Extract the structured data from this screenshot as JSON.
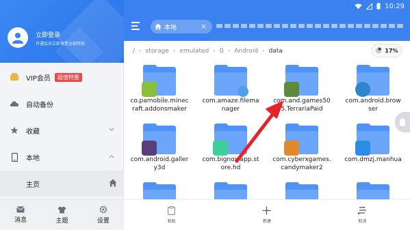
{
  "status_bar": {
    "time": "10:29"
  },
  "sidebar": {
    "login_title": "立即登录",
    "login_subtitle": "开通会员立即享受全部特权",
    "vip_label": "VIP会员",
    "vip_badge": "超值特惠",
    "backup_label": "自动备份",
    "favorites_label": "收藏",
    "local_label": "本地",
    "home_label": "主页",
    "bottom_tabs": [
      {
        "label": "消息",
        "icon": "mail-icon"
      },
      {
        "label": "主题",
        "icon": "shirt-icon"
      },
      {
        "label": "设置",
        "icon": "gear-icon"
      }
    ]
  },
  "toolbar": {
    "tab_label": "本地"
  },
  "breadcrumb": [
    "/",
    "storage",
    "emulated",
    "0",
    "Android",
    "data"
  ],
  "storage_percent": "17%",
  "files": [
    {
      "name_line1": "co.pamobile.minec",
      "name_line2": "raft.addonsmaker",
      "app_color": "#8bbf3a"
    },
    {
      "name_line1": "com.amaze.filema",
      "name_line2": "nager",
      "app_color": "#4fa0e8"
    },
    {
      "name_line1": "com.and.games50",
      "name_line2": "5.TerrariaPaid",
      "app_color": "#5a8a3a"
    },
    {
      "name_line1": "com.android.brow",
      "name_line2": "ser",
      "app_color": "#2d86c8"
    },
    {
      "name_line1": "com.android.galler",
      "name_line2": "y3d",
      "app_color": "#5a3d7a"
    },
    {
      "name_line1": "com.bignox.app.st",
      "name_line2": "ore.hd",
      "app_color": "#3ecf9b"
    },
    {
      "name_line1": "com.cyberxgames.",
      "name_line2": "candymaker2",
      "app_color": "#e08a2a"
    },
    {
      "name_line1": "com.dmzj.manhua",
      "name_line2": "",
      "app_color": "#2a8ee8"
    }
  ],
  "actions": [
    {
      "label": "粘贴",
      "icon": "paste-icon"
    },
    {
      "label": "新建",
      "icon": "plus-icon"
    },
    {
      "label": "取消",
      "icon": "cancel-icon"
    }
  ],
  "annotation_color": "#e8222a"
}
